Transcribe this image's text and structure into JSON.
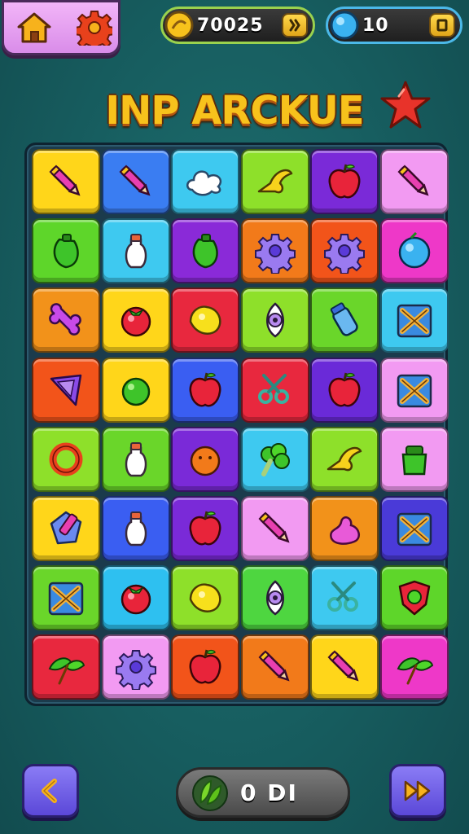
{
  "topbar": {
    "home_icon": "home-icon",
    "settings_icon": "gear-icon",
    "coins": {
      "value": "70025",
      "icon": "coin-icon",
      "button_icon": "pause-icon"
    },
    "gems": {
      "value": "10",
      "icon": "gem-icon",
      "button_icon": "square-icon"
    }
  },
  "title": {
    "text": "INP ARCKUE",
    "icon": "star-icon"
  },
  "colors": {
    "background": "#175e60",
    "board": "#1b3b4c",
    "title": "#f7c21c",
    "star": "#e8332a"
  },
  "board": {
    "columns": 6,
    "rows": 8,
    "tiles": [
      {
        "color": "#ffd61a",
        "icon": "pen"
      },
      {
        "color": "#3a7df2",
        "icon": "pen"
      },
      {
        "color": "#3ec9f0",
        "icon": "cloud"
      },
      {
        "color": "#8ee02a",
        "icon": "horn"
      },
      {
        "color": "#7a2ad8",
        "icon": "apple"
      },
      {
        "color": "#f29af2",
        "icon": "pen"
      },
      {
        "color": "#5ed62a",
        "icon": "pepper"
      },
      {
        "color": "#3ec9f0",
        "icon": "bottle"
      },
      {
        "color": "#8a2ad8",
        "icon": "pepper"
      },
      {
        "color": "#f27a1a",
        "icon": "gear"
      },
      {
        "color": "#f2541a",
        "icon": "gear"
      },
      {
        "color": "#ee38c8",
        "icon": "ball"
      },
      {
        "color": "#f2921a",
        "icon": "bone"
      },
      {
        "color": "#ffd61a",
        "icon": "tomato"
      },
      {
        "color": "#e8283e",
        "icon": "lemon"
      },
      {
        "color": "#8ee02a",
        "icon": "eye"
      },
      {
        "color": "#6ad62a",
        "icon": "jar"
      },
      {
        "color": "#3ec9f0",
        "icon": "cross-box"
      },
      {
        "color": "#f2541a",
        "icon": "kite"
      },
      {
        "color": "#ffd61a",
        "icon": "lime"
      },
      {
        "color": "#3a5ef2",
        "icon": "apple"
      },
      {
        "color": "#e8283e",
        "icon": "scissors"
      },
      {
        "color": "#6a2ad8",
        "icon": "apple"
      },
      {
        "color": "#f29af2",
        "icon": "cross-box"
      },
      {
        "color": "#8ee02a",
        "icon": "ring"
      },
      {
        "color": "#6ad62a",
        "icon": "bottle"
      },
      {
        "color": "#7a2ad8",
        "icon": "orange"
      },
      {
        "color": "#3ec9f0",
        "icon": "broccoli"
      },
      {
        "color": "#8ee02a",
        "icon": "horn"
      },
      {
        "color": "#f29af2",
        "icon": "pot"
      },
      {
        "color": "#ffd61a",
        "icon": "crystal"
      },
      {
        "color": "#3a5ef2",
        "icon": "bottle"
      },
      {
        "color": "#7a2ad8",
        "icon": "apple"
      },
      {
        "color": "#f29af2",
        "icon": "pen"
      },
      {
        "color": "#f2921a",
        "icon": "blob"
      },
      {
        "color": "#4a3ad8",
        "icon": "cross-box"
      },
      {
        "color": "#6ad62a",
        "icon": "cross-box"
      },
      {
        "color": "#2ec0f0",
        "icon": "tomato"
      },
      {
        "color": "#8ee02a",
        "icon": "lemon"
      },
      {
        "color": "#4ed640",
        "icon": "eye"
      },
      {
        "color": "#3ec9f0",
        "icon": "scissors"
      },
      {
        "color": "#5ed62a",
        "icon": "shield"
      },
      {
        "color": "#e8283e",
        "icon": "leaf"
      },
      {
        "color": "#f29af2",
        "icon": "gear"
      },
      {
        "color": "#f2541a",
        "icon": "apple"
      },
      {
        "color": "#f27a1a",
        "icon": "pen"
      },
      {
        "color": "#ffd61a",
        "icon": "pen"
      },
      {
        "color": "#ee38c8",
        "icon": "leaf"
      }
    ]
  },
  "footer": {
    "prev_icon": "chevron-left-icon",
    "next_icon": "fast-forward-icon",
    "score": {
      "value": "0 DI",
      "icon": "leaf-icon"
    }
  }
}
